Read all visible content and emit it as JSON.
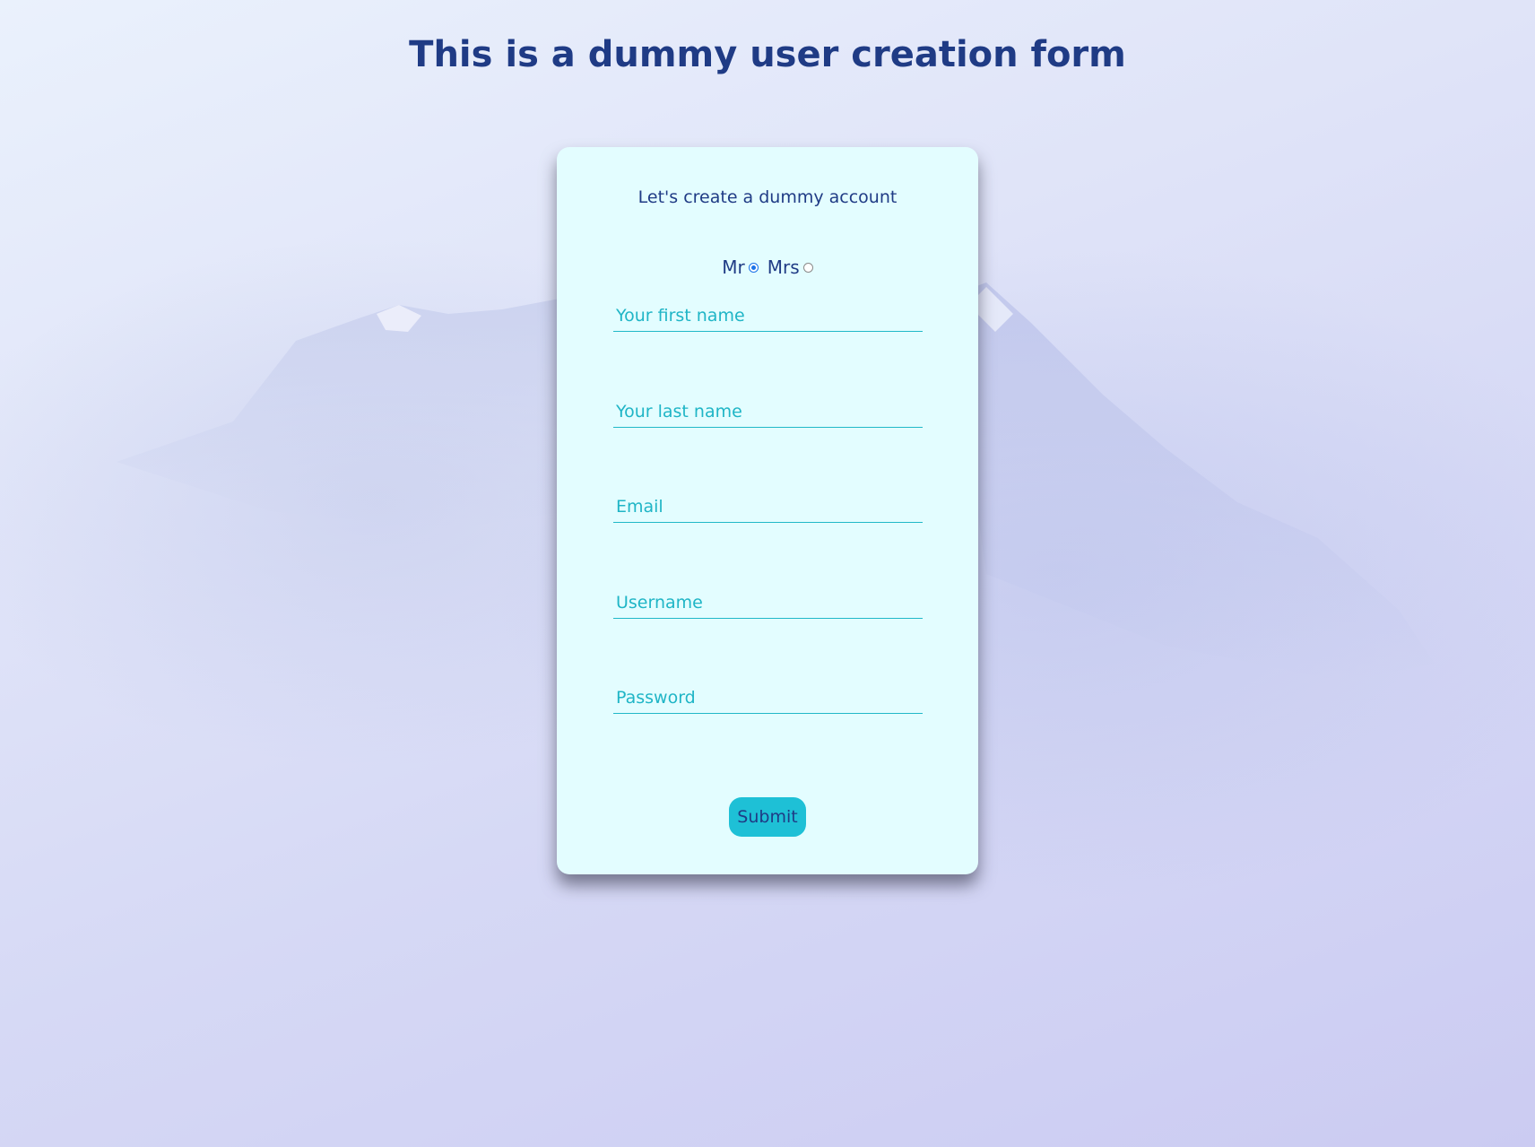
{
  "page": {
    "title": "This is a dummy user creation form"
  },
  "form": {
    "subtitle": "Let's create a dummy account",
    "title_options": [
      {
        "label": "Mr",
        "checked": true
      },
      {
        "label": "Mrs",
        "checked": false
      }
    ],
    "fields": {
      "first_name": {
        "placeholder": "Your first name",
        "value": ""
      },
      "last_name": {
        "placeholder": "Your last name",
        "value": ""
      },
      "email": {
        "placeholder": "Email",
        "value": ""
      },
      "username": {
        "placeholder": "Username",
        "value": ""
      },
      "password": {
        "placeholder": "Password",
        "value": ""
      }
    },
    "submit_label": "Submit"
  },
  "colors": {
    "heading_text": "#1f3b85",
    "card_background": "#e3fdff",
    "accent": "#1ec0d6",
    "placeholder_text": "#1fb5c6",
    "radio_checked": "#1a73e8"
  }
}
